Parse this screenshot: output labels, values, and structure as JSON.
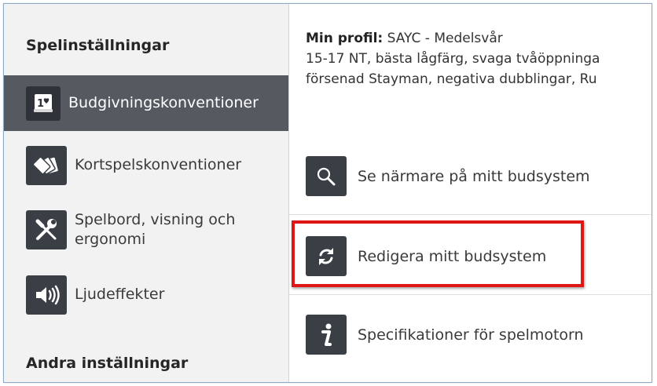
{
  "sidebar": {
    "section1_title": "Spelinställningar",
    "items": [
      {
        "label": "Budgivningskonventioner",
        "icon": "bidding-card-icon",
        "active": true
      },
      {
        "label": "Kortspelskonventioner",
        "icon": "cards-fan-icon",
        "active": false
      },
      {
        "label_line1": "Spelbord, visning och",
        "label_line2": "ergonomi",
        "icon": "tools-icon",
        "active": false
      },
      {
        "label": "Ljudeffekter",
        "icon": "speaker-icon",
        "active": false
      }
    ],
    "section2_title": "Andra inställningar"
  },
  "main": {
    "profile_label": "Min profil:",
    "profile_value": " SAYC - Medelsvår",
    "profile_line2": "15-17 NT, bästa lågfärg, svaga tvåöppninga",
    "profile_line3": "försenad Stayman, negativa dubblingar, Ru",
    "actions": [
      {
        "label": "Se närmare på mitt budsystem",
        "icon": "search-icon"
      },
      {
        "label": "Redigera mitt budsystem",
        "icon": "refresh-icon"
      },
      {
        "label": "Specifikationer för spelmotorn",
        "icon": "info-icon"
      }
    ]
  },
  "colors": {
    "sidebar_bg": "#f2f2f2",
    "active_bg": "#555a61",
    "icon_bg": "#3a3f46",
    "highlight": "#e01616"
  }
}
